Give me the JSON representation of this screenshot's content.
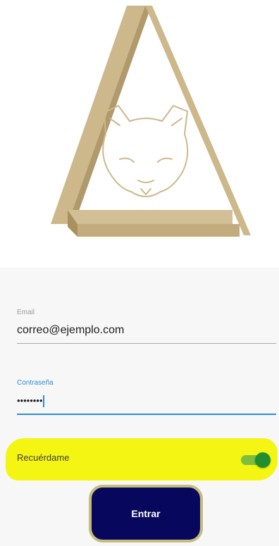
{
  "login_form": {
    "email_label": "Email",
    "email_value": "correo@ejemplo.com",
    "password_label": "Contraseña",
    "password_value": "••••••••",
    "remember_label": "Recuérdame",
    "remember_enabled": true,
    "submit_label": "Entrar"
  },
  "colors": {
    "logo_gold": "#c8b48a",
    "focus_blue": "#2d8cd8",
    "highlight_yellow": "#f5f513",
    "toggle_green": "#1f8f2f",
    "button_navy": "#07075e"
  },
  "icons": {
    "logo": "triangle-cougar-logo"
  }
}
